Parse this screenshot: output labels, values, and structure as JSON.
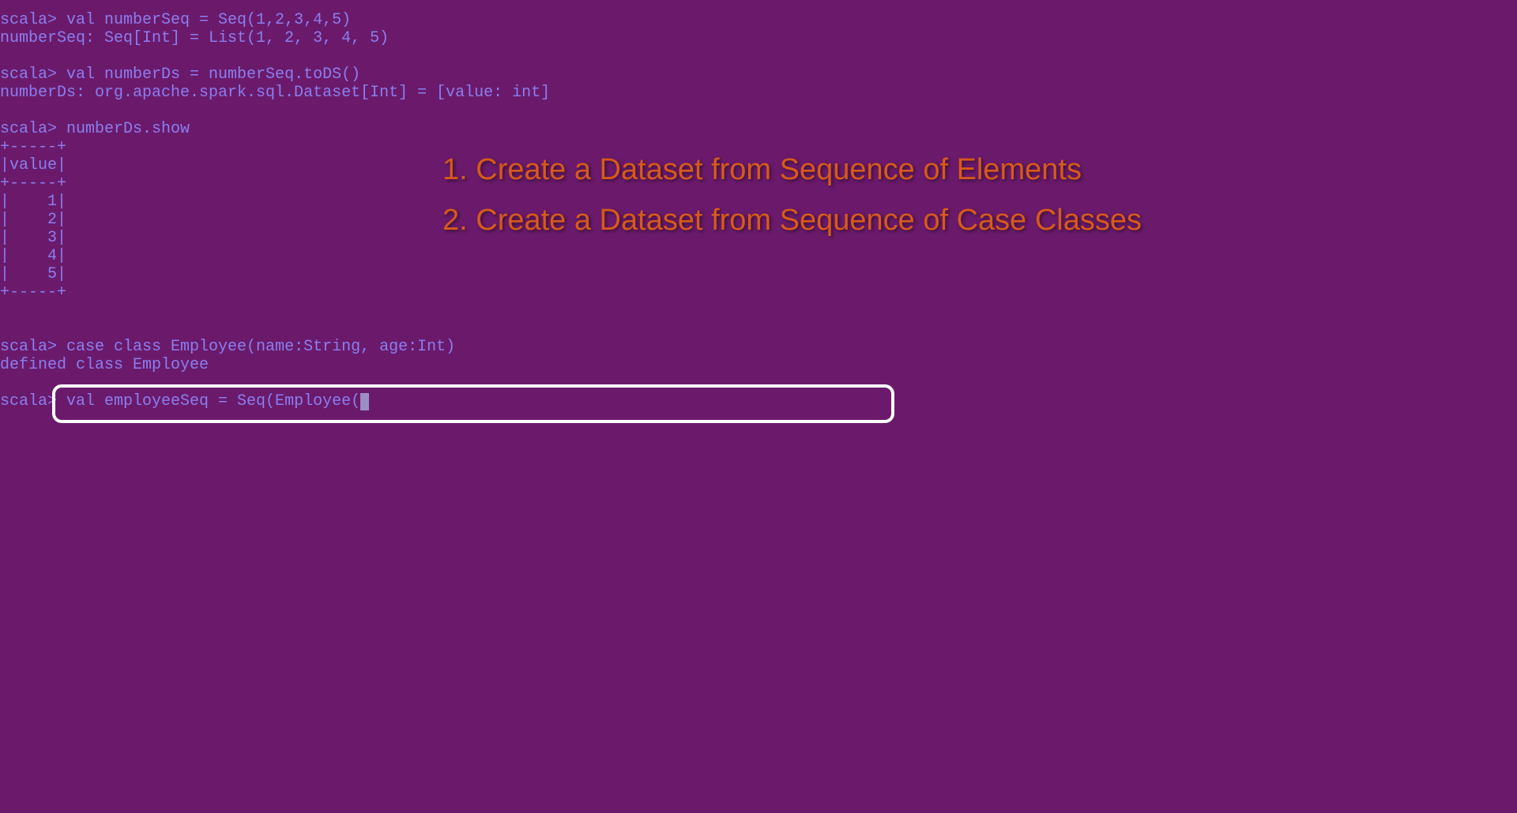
{
  "terminal": {
    "prompt": "scala>",
    "line1_cmd": " val numberSeq = Seq(1,2,3,4,5)",
    "line1_out": "numberSeq: Seq[Int] = List(1, 2, 3, 4, 5)",
    "line2_cmd": " val numberDs = numberSeq.toDS()",
    "line2_out": "numberDs: org.apache.spark.sql.Dataset[Int] = [value: int]",
    "line3_cmd": " numberDs.show",
    "table_border": "+-----+",
    "table_header": "|value|",
    "table_row1": "|    1|",
    "table_row2": "|    2|",
    "table_row3": "|    3|",
    "table_row4": "|    4|",
    "table_row5": "|    5|",
    "line4_cmd": " case class Employee(name:String, age:Int)",
    "line4_out": "defined class Employee",
    "line5_cmd": " val employeeSeq = Seq(Employee("
  },
  "overlay": {
    "item1": "1. Create a Dataset from Sequence of Elements",
    "item2": "2. Create a Dataset from Sequence of Case Classes"
  },
  "chart_data": {
    "type": "table",
    "title": "numberDs.show",
    "columns": [
      "value"
    ],
    "rows": [
      [
        1
      ],
      [
        2
      ],
      [
        3
      ],
      [
        4
      ],
      [
        5
      ]
    ]
  }
}
